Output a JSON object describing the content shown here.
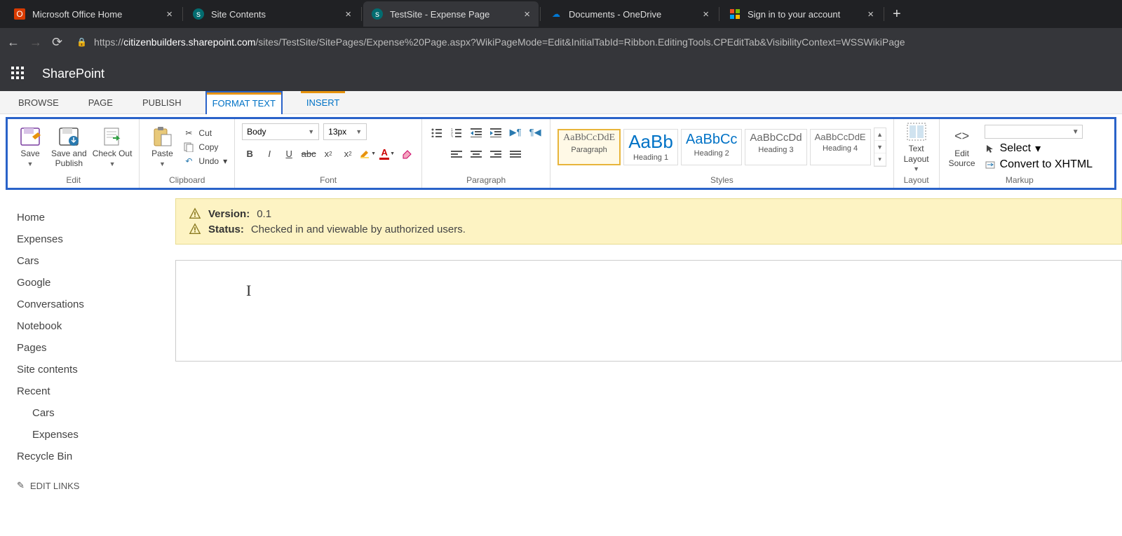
{
  "browser": {
    "tabs": [
      {
        "title": "Microsoft Office Home",
        "favicon": "office"
      },
      {
        "title": "Site Contents",
        "favicon": "sp"
      },
      {
        "title": "TestSite - Expense Page",
        "favicon": "sp",
        "active": true
      },
      {
        "title": "Documents - OneDrive",
        "favicon": "onedrive"
      },
      {
        "title": "Sign in to your account",
        "favicon": "ms"
      }
    ],
    "url_prefix": "https://",
    "url_host": "citizenbuilders.sharepoint.com",
    "url_path": "/sites/TestSite/SitePages/Expense%20Page.aspx?WikiPageMode=Edit&InitialTabId=Ribbon.EditingTools.CPEditTab&VisibilityContext=WSSWikiPage"
  },
  "suite": {
    "title": "SharePoint"
  },
  "ribbon_tabs": {
    "browse": "BROWSE",
    "page": "PAGE",
    "publish": "PUBLISH",
    "format_text": "FORMAT TEXT",
    "insert": "INSERT"
  },
  "ribbon": {
    "edit": {
      "save": "Save",
      "save_publish": "Save and\nPublish",
      "check_out": "Check Out",
      "label": "Edit"
    },
    "clipboard": {
      "paste": "Paste",
      "cut": "Cut",
      "copy": "Copy",
      "undo": "Undo",
      "label": "Clipboard"
    },
    "font": {
      "family": "Body",
      "size": "13px",
      "label": "Font"
    },
    "paragraph": {
      "label": "Paragraph"
    },
    "styles": {
      "items": [
        {
          "sample": "AaBbCcDdE",
          "label": "Paragraph",
          "active": true,
          "cls": "small"
        },
        {
          "sample": "AaBb",
          "label": "Heading 1",
          "cls": ""
        },
        {
          "sample": "AaBbCc",
          "label": "Heading 2",
          "cls": ""
        },
        {
          "sample": "AaBbCcDd",
          "label": "Heading 3",
          "cls": ""
        },
        {
          "sample": "AaBbCcDdE",
          "label": "Heading 4",
          "cls": ""
        }
      ],
      "label": "Styles"
    },
    "layout": {
      "text_layout": "Text\nLayout",
      "label": "Layout"
    },
    "markup": {
      "edit_source": "Edit\nSource",
      "select": "Select",
      "convert": "Convert to XHTML",
      "label": "Markup"
    }
  },
  "status": {
    "version_label": "Version:",
    "version_value": "0.1",
    "status_label": "Status:",
    "status_value": "Checked in and viewable by authorized users."
  },
  "nav": {
    "items": [
      "Home",
      "Expenses",
      "Cars",
      "Google",
      "Conversations",
      "Notebook",
      "Pages",
      "Site contents",
      "Recent"
    ],
    "sub": [
      "Cars",
      "Expenses"
    ],
    "recycle": "Recycle Bin",
    "edit_links": "EDIT LINKS"
  }
}
